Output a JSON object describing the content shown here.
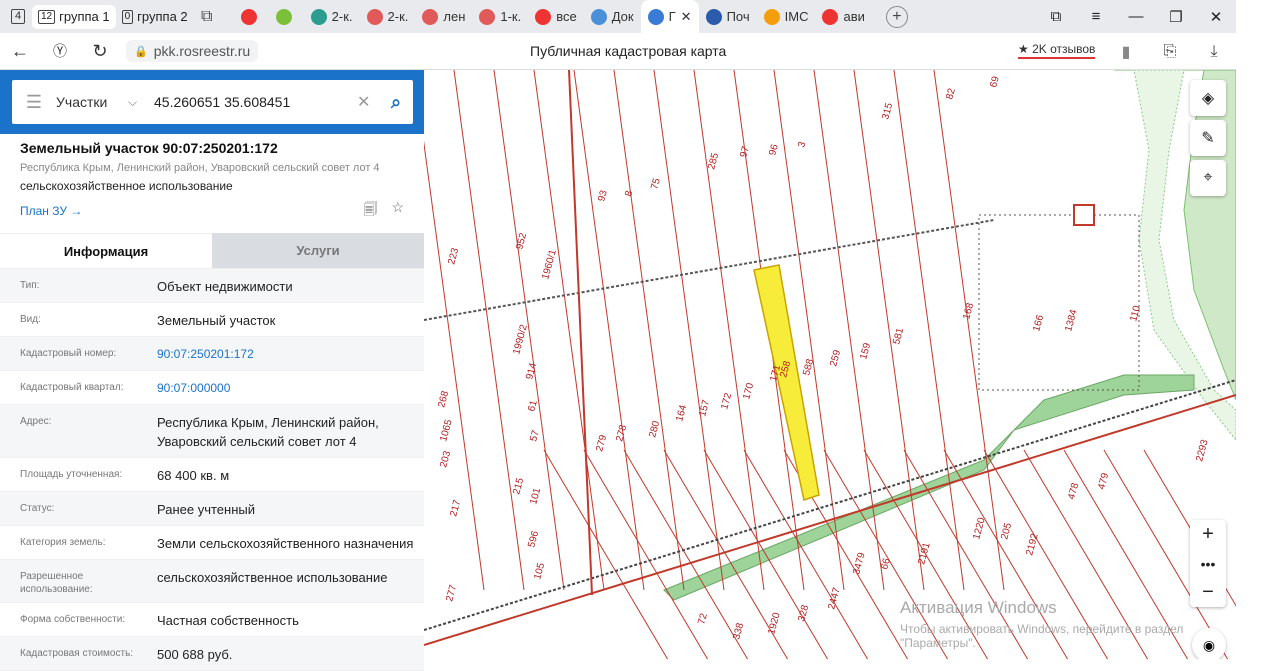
{
  "browser": {
    "tab_count": "4",
    "groups": [
      {
        "count": "12",
        "label": "группа 1",
        "active": true
      },
      {
        "count": "0",
        "label": "группа 2",
        "active": false
      }
    ],
    "tabs": [
      {
        "label": "",
        "color": "#e33"
      },
      {
        "label": "",
        "color": "#7cbf3a"
      },
      {
        "label": "2-к.",
        "color": "#2a9d8f"
      },
      {
        "label": "2-к.",
        "color": "#e05a5a"
      },
      {
        "label": "лен",
        "color": "#e05a5a"
      },
      {
        "label": "1-к.",
        "color": "#e05a5a"
      },
      {
        "label": "все",
        "color": "#e33"
      },
      {
        "label": "Док",
        "color": "#4a90d9"
      },
      {
        "label": "Г",
        "color": "#3a7bd5",
        "active": true
      },
      {
        "label": "Поч",
        "color": "#2b5cab"
      },
      {
        "label": "IMC",
        "color": "#f59e0b"
      },
      {
        "label": "ави",
        "color": "#e33"
      }
    ],
    "url": "pkk.rosreestr.ru",
    "page_title": "Публичная кадастровая карта",
    "reviews": "2K отзывов"
  },
  "search": {
    "type_label": "Участки",
    "query": "45.260651 35.608451"
  },
  "object": {
    "title": "Земельный участок 90:07:250201:172",
    "address_short": "Республика Крым, Ленинский район, Уваровский сельский совет лот 4",
    "use": "сельскохозяйственное использование",
    "plan_link": "План ЗУ →"
  },
  "info_tabs": {
    "info": "Информация",
    "services": "Услуги"
  },
  "rows": [
    {
      "key": "Тип:",
      "value": "Объект недвижимости",
      "link": false
    },
    {
      "key": "Вид:",
      "value": "Земельный участок",
      "link": false
    },
    {
      "key": "Кадастровый номер:",
      "value": "90:07:250201:172",
      "link": true
    },
    {
      "key": "Кадастровый квартал:",
      "value": "90:07:000000",
      "link": true
    },
    {
      "key": "Адрес:",
      "value": "Республика Крым, Ленинский район, Уваровский сельский совет лот 4",
      "link": false
    },
    {
      "key": "Площадь уточненная:",
      "value": "68 400 кв. м",
      "link": false
    },
    {
      "key": "Статус:",
      "value": "Ранее учтенный",
      "link": false
    },
    {
      "key": "Категория земель:",
      "value": "Земли сельскохозяйственного назначения",
      "link": false
    },
    {
      "key": "Разрешенное использование:",
      "value": "сельскохозяйственное использование",
      "link": false
    },
    {
      "key": "Форма собственности:",
      "value": "Частная собственность",
      "link": false
    },
    {
      "key": "Кадастровая стоимость:",
      "value": "500 688 руб.",
      "link": false
    }
  ],
  "map": {
    "parcel_labels": [
      "82",
      "69",
      "315",
      "285",
      "97",
      "96",
      "3",
      "93",
      "8",
      "75",
      "952",
      "223",
      "1960/1",
      "1990/2",
      "914",
      "268",
      "61",
      "1065",
      "57",
      "203",
      "215",
      "217",
      "101",
      "596",
      "105",
      "277",
      "279",
      "278",
      "280",
      "164",
      "157",
      "172",
      "170",
      "171",
      "258",
      "588",
      "259",
      "159",
      "581",
      "168",
      "166",
      "1384",
      "110",
      "2293",
      "478",
      "479",
      "1220",
      "205",
      "2192",
      "2191",
      "66",
      "3479",
      "2447",
      "328",
      "1920",
      "338",
      "72"
    ],
    "watermark_title": "Активация Windows",
    "watermark_sub": "Чтобы активировать Windows, перейдите в раздел \"Параметры\"."
  }
}
